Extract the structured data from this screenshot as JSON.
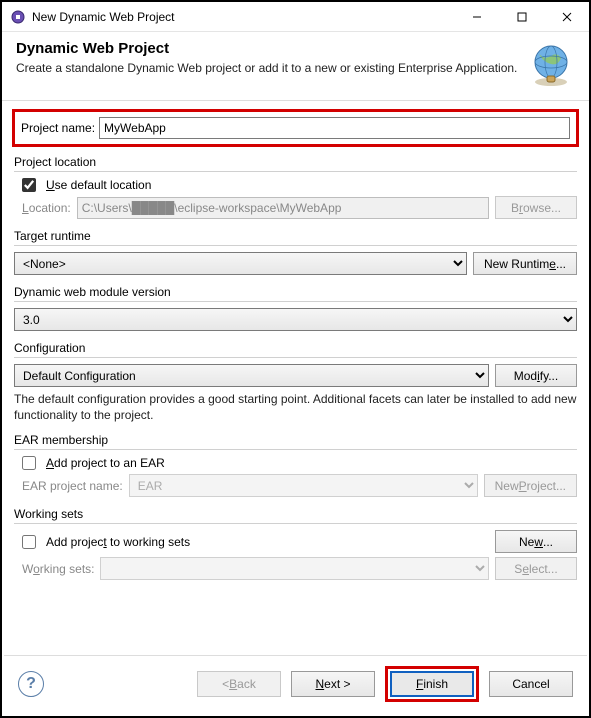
{
  "window": {
    "title": "New Dynamic Web Project"
  },
  "banner": {
    "title": "Dynamic Web Project",
    "description": "Create a standalone Dynamic Web project or add it to a new or existing Enterprise Application."
  },
  "projectName": {
    "label": "Project name:",
    "value": "MyWebApp"
  },
  "projectLocation": {
    "group": "Project location",
    "useDefaultLabel": "Use default location",
    "useDefaultChecked": true,
    "locationLabel": "Location:",
    "locationValue": "C:\\Users\\█████\\eclipse-workspace\\MyWebApp",
    "browse": "Browse..."
  },
  "targetRuntime": {
    "group": "Target runtime",
    "value": "<None>",
    "newRuntime": "New Runtime..."
  },
  "moduleVersion": {
    "group": "Dynamic web module version",
    "value": "3.0"
  },
  "configuration": {
    "group": "Configuration",
    "value": "Default Configuration",
    "modify": "Modify...",
    "description": "The default configuration provides a good starting point. Additional facets can later be installed to add new functionality to the project."
  },
  "ear": {
    "group": "EAR membership",
    "addLabel": "Add project to an EAR",
    "addChecked": false,
    "projectNameLabel": "EAR project name:",
    "projectNameValue": "EAR",
    "newProject": "New Project..."
  },
  "workingSets": {
    "group": "Working sets",
    "addLabel": "Add project to working sets",
    "addChecked": false,
    "new": "New...",
    "label": "Working sets:",
    "value": "",
    "select": "Select..."
  },
  "footer": {
    "back": "Back",
    "next": "Next >",
    "finish": "Finish",
    "cancel": "Cancel"
  }
}
